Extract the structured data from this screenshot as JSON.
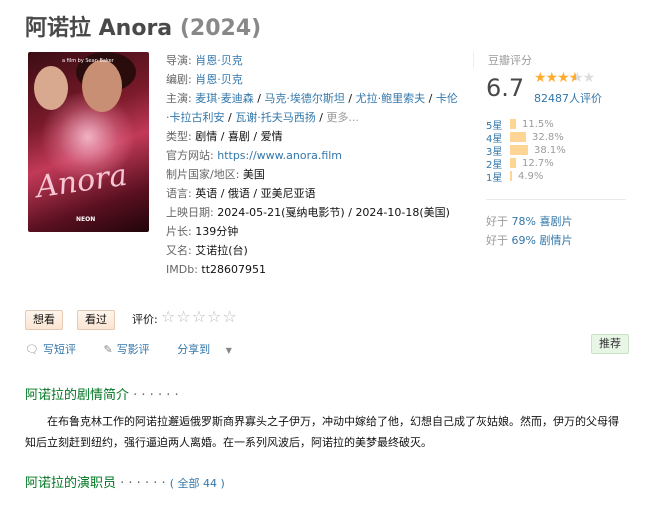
{
  "title": {
    "name": "阿诺拉 Anora",
    "year": "(2024)"
  },
  "poster": {
    "script_text": "Anora",
    "small_text": "a film by Sean Baker",
    "logo": "NEON"
  },
  "info": {
    "director_label": "导演:",
    "director": "肖恩·贝克",
    "writer_label": "编剧:",
    "writer": "肖恩·贝克",
    "cast_label": "主演:",
    "cast": [
      "麦琪·麦迪森",
      "马克·埃德尔斯坦",
      "尤拉·鲍里索夫",
      "卡伦·卡拉古利安",
      "瓦谢·托夫马西扬"
    ],
    "cast_more": "更多...",
    "genre_label": "类型:",
    "genres": [
      "剧情",
      "喜剧",
      "爱情"
    ],
    "website_label": "官方网站:",
    "website": "https://www.anora.film",
    "country_label": "制片国家/地区:",
    "country": "美国",
    "language_label": "语言:",
    "language": "英语 / 俄语 / 亚美尼亚语",
    "release_label": "上映日期:",
    "release": [
      "2024-05-21(戛纳电影节)",
      "2024-10-18(美国)"
    ],
    "runtime_label": "片长:",
    "runtime": "139分钟",
    "aka_label": "又名:",
    "aka": "艾诺拉(台)",
    "imdb_label": "IMDb:",
    "imdb": "tt28607951"
  },
  "rating": {
    "header": "豆瓣评分",
    "score": "6.7",
    "stars": 3.5,
    "votes": "82487人评价",
    "distribution": [
      {
        "label": "5星",
        "pct": "11.5%",
        "value": 11.5
      },
      {
        "label": "4星",
        "pct": "32.8%",
        "value": 32.8
      },
      {
        "label": "3星",
        "pct": "38.1%",
        "value": 38.1
      },
      {
        "label": "2星",
        "pct": "12.7%",
        "value": 12.7
      },
      {
        "label": "1星",
        "pct": "4.9%",
        "value": 4.9
      }
    ],
    "better_than": [
      {
        "prefix": "好于",
        "pct": "78%",
        "genre": "喜剧片"
      },
      {
        "prefix": "好于",
        "pct": "69%",
        "genre": "剧情片"
      }
    ]
  },
  "interest": {
    "want_label": "想看",
    "seen_label": "看过",
    "rate_label": "评价:",
    "rate_stars": "☆☆☆☆☆"
  },
  "actions": {
    "short_review": "写短评",
    "review": "写影评",
    "share": "分享到",
    "recommend": "推荐"
  },
  "synopsis": {
    "title": "阿诺拉的剧情简介",
    "dots": "· · · · · ·",
    "text": "在布鲁克林工作的阿诺拉邂逅俄罗斯商界寡头之子伊万，冲动中嫁给了他，幻想自己成了灰姑娘。然而，伊万的父母得知后立刻赶到纽约，强行逼迫两人离婚。在一系列风波后，阿诺拉的美梦最终破灭。"
  },
  "cast_section": {
    "title": "阿诺拉的演职员",
    "dots": "· · · · · ·",
    "all": "( 全部 44 )"
  },
  "colors": {
    "link": "#3377aa",
    "green": "#007722",
    "star": "#ffac2d",
    "bar": "#ffd596"
  }
}
